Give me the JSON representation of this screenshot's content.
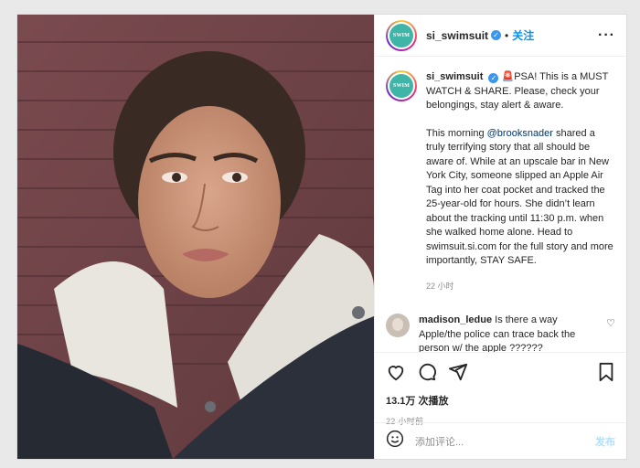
{
  "post": {
    "username": "si_swimsuit",
    "follow_label": "关注",
    "avatar_text": "SWIM",
    "more_icon": "more-horizontal-icon"
  },
  "caption": {
    "username": "si_swimsuit",
    "emoji": "🚨",
    "intro": "PSA! This is a MUST WATCH & SHARE. Please, check your belongings, stay alert & aware.",
    "p2_before": "This morning ",
    "mention": "@brooksnader",
    "p2_after": " shared a truly terrifying story that all should be aware of. While at an upscale bar in New York City, someone slipped an Apple Air Tag into her coat pocket and tracked the 25-year-old for hours. She didn’t learn about the tracking until 11:30 p.m. when she walked home alone. Head to swimsuit.si.com for the full story and more importantly, STAY SAFE.",
    "time": "22 小时"
  },
  "comment": {
    "username": "madison_ledue",
    "text": "Is there a way Apple/the police can trace back the person w/ the apple ??????"
  },
  "actions": {
    "views": "13.1万 次播放",
    "time": "22 小时前"
  },
  "add_comment": {
    "placeholder": "添加评论...",
    "post_label": "发布"
  },
  "colors": {
    "accent": "#0095f6",
    "verified": "#3897f0",
    "post_disabled": "#b2dffc"
  }
}
